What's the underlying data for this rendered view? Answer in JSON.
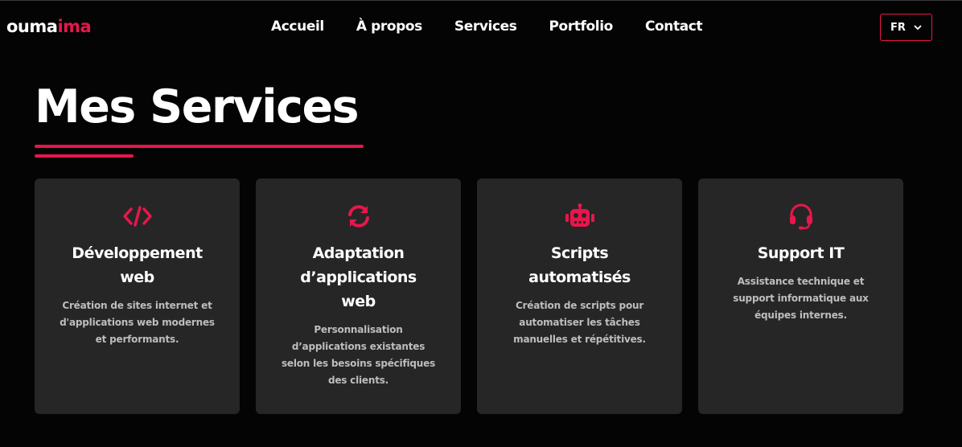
{
  "brand": {
    "part1": "ouma",
    "part2": "ima"
  },
  "nav": {
    "items": [
      {
        "label": "Accueil"
      },
      {
        "label": "À propos"
      },
      {
        "label": "Services"
      },
      {
        "label": "Portfolio"
      },
      {
        "label": "Contact"
      }
    ]
  },
  "language": {
    "selected": "FR"
  },
  "section": {
    "title": "Mes Services"
  },
  "colors": {
    "accent": "#e8164c",
    "background": "#040404",
    "card": "#262626"
  },
  "services": [
    {
      "icon": "code-icon",
      "title": "Développement web",
      "description": "Création de sites internet et d'applications web modernes et performants."
    },
    {
      "icon": "sync-icon",
      "title": "Adaptation d’applications web",
      "description": "Personnalisation d’applications existantes selon les besoins spécifiques des clients."
    },
    {
      "icon": "robot-icon",
      "title": "Scripts automatisés",
      "description": "Création de scripts pour automatiser les tâches manuelles et répétitives."
    },
    {
      "icon": "headset-icon",
      "title": "Support IT",
      "description": "Assistance technique et support informatique aux équipes internes."
    }
  ]
}
